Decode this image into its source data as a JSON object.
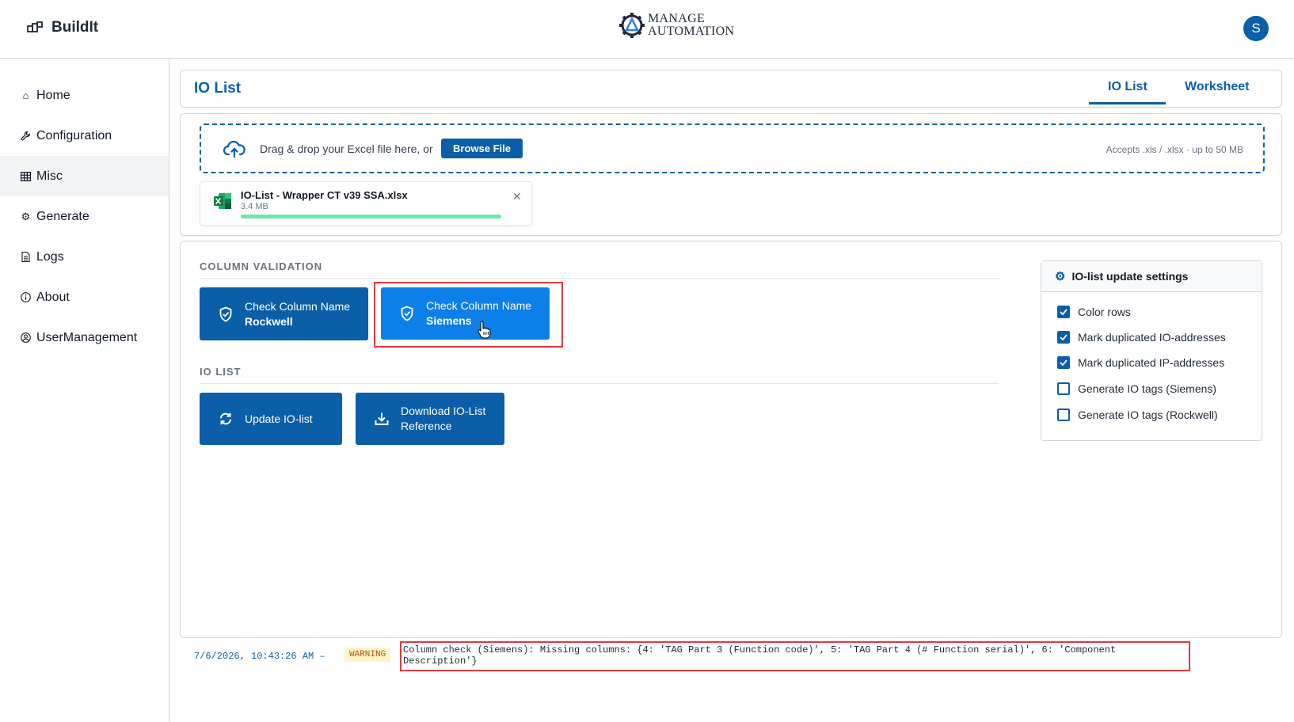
{
  "app": {
    "name": "BuildIt",
    "logo_line1": "MANAGE",
    "logo_line2": "AUTOMATION",
    "avatar_initial": "S"
  },
  "sidebar": {
    "items": [
      {
        "label": "Home",
        "icon": "home-icon"
      },
      {
        "label": "Configuration",
        "icon": "wrench-icon"
      },
      {
        "label": "Misc",
        "icon": "grid-icon",
        "active": true
      },
      {
        "label": "Generate",
        "icon": "gear-icon"
      },
      {
        "label": "Logs",
        "icon": "document-icon"
      },
      {
        "label": "About",
        "icon": "info-icon"
      },
      {
        "label": "UserManagement",
        "icon": "user-circle-icon"
      }
    ]
  },
  "header": {
    "title": "IO List",
    "tabs": [
      {
        "label": "IO List",
        "active": true
      },
      {
        "label": "Worksheet",
        "active": false
      }
    ]
  },
  "upload": {
    "drop_text": "Drag & drop your Excel file here, or",
    "browse_label": "Browse File",
    "accepts_text": "Accepts .xls / .xlsx · up to 50 MB",
    "file": {
      "name": "IO-List - Wrapper CT v39 SSA.xlsx",
      "size": "3.4 MB",
      "progress": 1.0
    }
  },
  "column_validation": {
    "label": "COLUMN VALIDATION",
    "buttons": [
      {
        "line1": "Check Column Name",
        "line2": "Rockwell"
      },
      {
        "line1": "Check Column Name",
        "line2": "Siemens"
      }
    ]
  },
  "io_list": {
    "label": "IO LIST",
    "update_label": "Update IO-list",
    "download_line1": "Download IO-List",
    "download_line2": "Reference"
  },
  "settings": {
    "title": "IO-list update settings",
    "options": [
      {
        "label": "Color rows",
        "checked": true
      },
      {
        "label": "Mark duplicated IO-addresses",
        "checked": true
      },
      {
        "label": "Mark duplicated IP-addresses",
        "checked": true
      },
      {
        "label": "Generate IO tags (Siemens)",
        "checked": false
      },
      {
        "label": "Generate IO tags (Rockwell)",
        "checked": false
      }
    ]
  },
  "log": {
    "timestamp": "7/6/2026, 10:43:26 AM –",
    "level": "WARNING",
    "message": "Column check (Siemens): Missing columns: {4: 'TAG Part 3 (Function code)', 5: 'TAG Part 4 (# Function serial)', 6: 'Component Description'}"
  },
  "colors": {
    "primary": "#0b5ea8",
    "accent": "#0d7fe8",
    "highlight": "#e5383b",
    "progress": "#6ee7a8",
    "warning_bg": "#fef3c7"
  }
}
